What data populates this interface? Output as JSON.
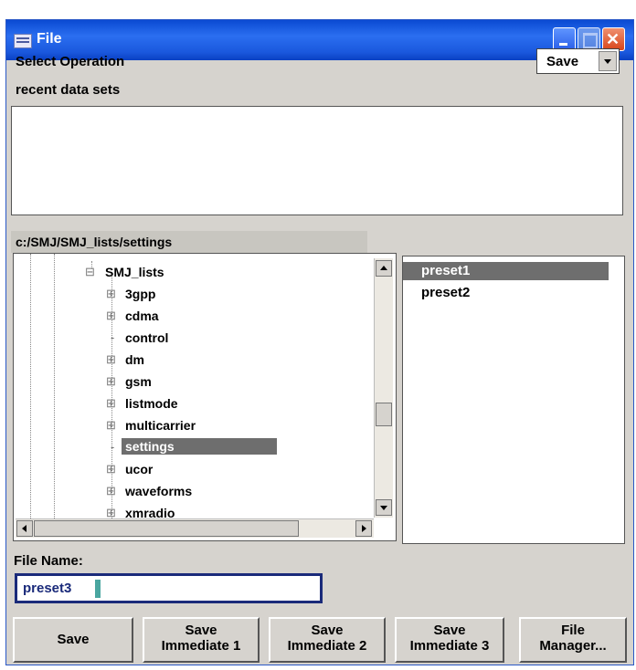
{
  "window": {
    "title": "File",
    "icon": "file-dialog-icon"
  },
  "select_operation": {
    "label": "Select Operation",
    "value": "Save"
  },
  "recent": {
    "label": "recent data sets"
  },
  "path": "c:/SMJ/SMJ_lists/settings",
  "tree": {
    "items": [
      {
        "label": "SMJ_lists"
      },
      {
        "label": "3gpp"
      },
      {
        "label": "cdma"
      },
      {
        "label": "control"
      },
      {
        "label": "dm"
      },
      {
        "label": "gsm"
      },
      {
        "label": "listmode"
      },
      {
        "label": "multicarrier"
      },
      {
        "label": "settings",
        "selected": true
      },
      {
        "label": "ucor"
      },
      {
        "label": "waveforms"
      },
      {
        "label": "xmradio"
      }
    ]
  },
  "files": {
    "items": [
      {
        "label": "preset1",
        "selected": true
      },
      {
        "label": "preset2"
      }
    ]
  },
  "file_name": {
    "label": "File Name:",
    "value": "preset3"
  },
  "buttons": {
    "save": "Save",
    "save_immediate_1": [
      "Save",
      "Immediate 1"
    ],
    "save_immediate_2": [
      "Save",
      "Immediate 2"
    ],
    "save_immediate_3": [
      "Save",
      "Immediate 3"
    ],
    "file_manager": [
      "File",
      "Manager..."
    ]
  }
}
